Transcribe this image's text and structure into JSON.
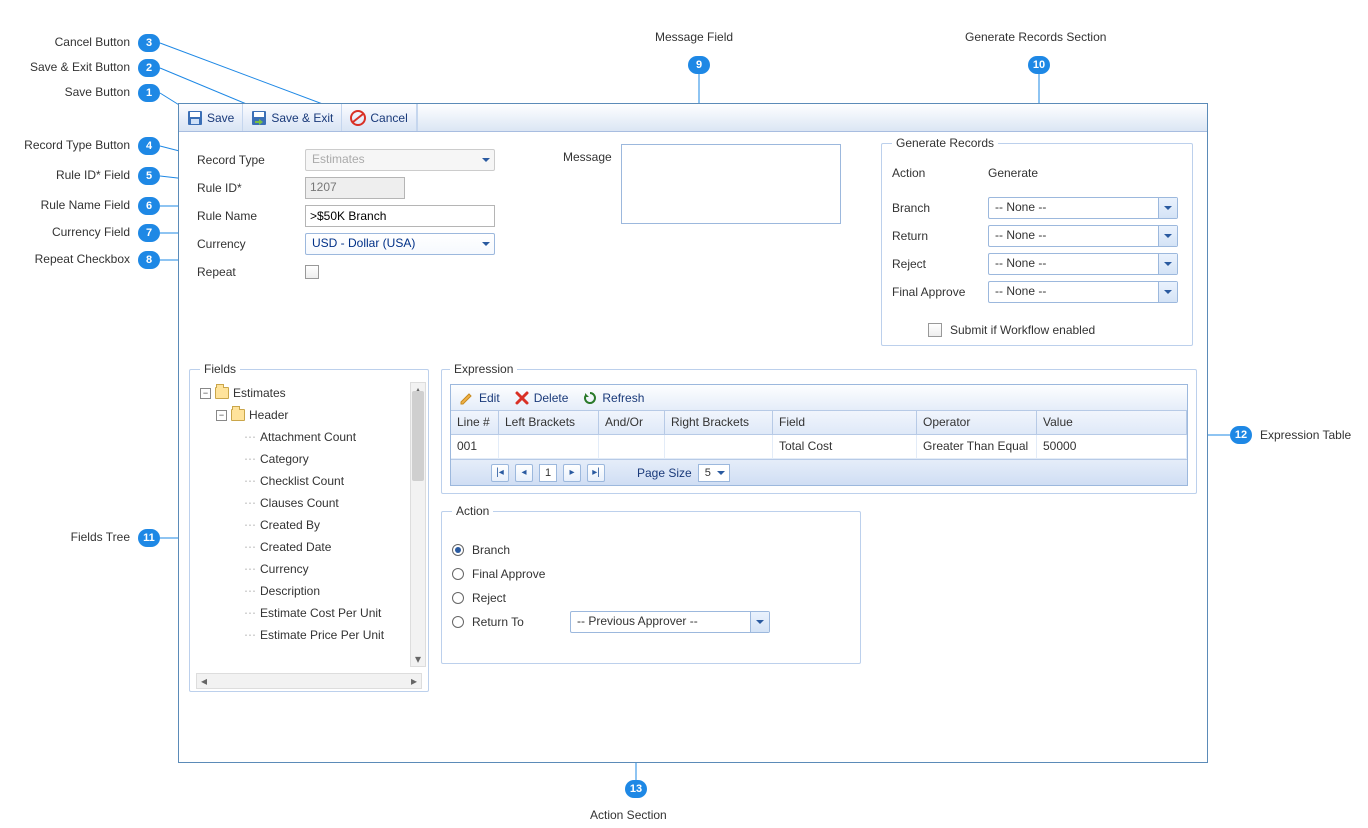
{
  "callouts": {
    "1": "Save Button",
    "2": "Save & Exit Button",
    "3": "Cancel Button",
    "4": "Record Type Button",
    "5": "Rule ID* Field",
    "6": "Rule Name Field",
    "7": "Currency Field",
    "8": "Repeat Checkbox",
    "9": "Message Field",
    "10": "Generate Records Section",
    "11": "Fields Tree",
    "12": "Expression Table",
    "13": "Action Section"
  },
  "toolbar": {
    "save": "Save",
    "save_exit": "Save & Exit",
    "cancel": "Cancel"
  },
  "form": {
    "record_type_label": "Record Type",
    "record_type_value": "Estimates",
    "rule_id_label": "Rule ID*",
    "rule_id_value": "1207",
    "rule_name_label": "Rule Name",
    "rule_name_value": ">$50K Branch",
    "currency_label": "Currency",
    "currency_value": "USD - Dollar (USA)",
    "repeat_label": "Repeat",
    "message_label": "Message"
  },
  "generate": {
    "legend": "Generate Records",
    "action_label": "Action",
    "action_value": "Generate",
    "branch_label": "Branch",
    "branch_value": "-- None --",
    "return_label": "Return",
    "return_value": "-- None --",
    "reject_label": "Reject",
    "reject_value": "-- None --",
    "final_label": "Final Approve",
    "final_value": "-- None --",
    "submit_label": "Submit if Workflow enabled"
  },
  "fieldset_fields": "Fields",
  "tree": {
    "root": "Estimates",
    "group": "Header",
    "items": [
      "Attachment Count",
      "Category",
      "Checklist Count",
      "Clauses Count",
      "Created By",
      "Created Date",
      "Currency",
      "Description",
      "Estimate Cost Per Unit",
      "Estimate Price Per Unit"
    ]
  },
  "expression": {
    "legend": "Expression",
    "toolbar": {
      "edit": "Edit",
      "delete": "Delete",
      "refresh": "Refresh"
    },
    "headers": [
      "Line #",
      "Left Brackets",
      "And/Or",
      "Right Brackets",
      "Field",
      "Operator",
      "Value"
    ],
    "row": {
      "line": "001",
      "lb": "",
      "ao": "",
      "rb": "",
      "field": "Total Cost",
      "op": "Greater Than Equal",
      "val": "50000"
    },
    "pager": {
      "page_size_label": "Page Size",
      "page_size_value": "5"
    }
  },
  "action": {
    "legend": "Action",
    "branch": "Branch",
    "final": "Final Approve",
    "reject": "Reject",
    "return": "Return To",
    "return_value": "-- Previous Approver --"
  }
}
